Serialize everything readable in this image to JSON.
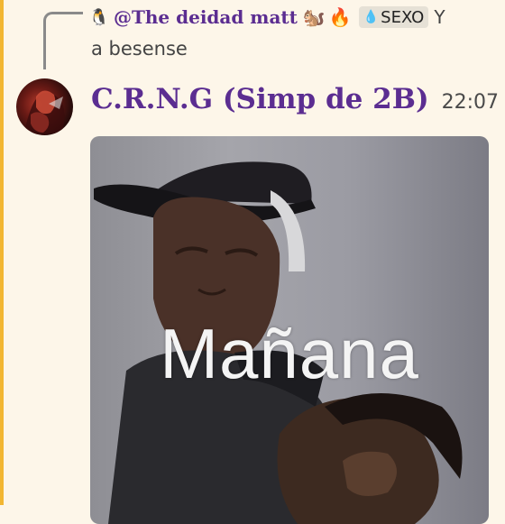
{
  "reply": {
    "lead_emoji": "🐧",
    "author": "@The deidad matt",
    "emojis": [
      "🐿️",
      "🔥"
    ],
    "role_tag": "SEXO",
    "role_icon": "💧",
    "text_line1": "Y",
    "text_line2": "a besense"
  },
  "message": {
    "username": "C.R.N.G (Simp de 2B)",
    "timestamp": "22:07"
  },
  "attachment": {
    "caption": "Mañana"
  },
  "colors": {
    "background": "#fdf6e9",
    "accent_bar": "#f2b632",
    "username": "#5b2d91",
    "timestamp": "#4a4a4a"
  }
}
